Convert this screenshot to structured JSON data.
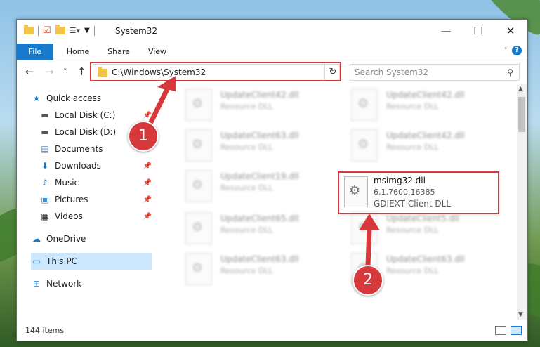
{
  "window": {
    "title": "System32",
    "controls": {
      "minimize": "—",
      "maximize": "☐",
      "close": "✕"
    }
  },
  "ribbon": {
    "tabs": [
      "File",
      "Home",
      "Share",
      "View"
    ],
    "expand_glyph": "˅",
    "help_glyph": "?"
  },
  "navigation": {
    "back_glyph": "←",
    "forward_glyph": "→",
    "recent_glyph": "˅",
    "up_glyph": "↑",
    "address_path": "C:\\Windows\\System32",
    "address_dropdown_glyph": "˅",
    "refresh_glyph": "↻",
    "search_placeholder": "Search System32",
    "search_glyph": "⚲"
  },
  "sidebar": {
    "items": [
      {
        "label": "Quick access",
        "icon": "star-icon",
        "glyph": "★",
        "pinned": false
      },
      {
        "label": "Local Disk (C:)",
        "icon": "drive-icon",
        "glyph": "▬",
        "pinned": true
      },
      {
        "label": "Local Disk (D:)",
        "icon": "drive-icon",
        "glyph": "▬",
        "pinned": true
      },
      {
        "label": "Documents",
        "icon": "documents-icon",
        "glyph": "▤",
        "pinned": true
      },
      {
        "label": "Downloads",
        "icon": "download-icon",
        "glyph": "⬇",
        "pinned": true
      },
      {
        "label": "Music",
        "icon": "music-icon",
        "glyph": "♪",
        "pinned": true
      },
      {
        "label": "Pictures",
        "icon": "pictures-icon",
        "glyph": "▣",
        "pinned": true
      },
      {
        "label": "Videos",
        "icon": "videos-icon",
        "glyph": "▦",
        "pinned": true
      },
      {
        "label": "OneDrive",
        "icon": "cloud-icon",
        "glyph": "☁",
        "pinned": false
      },
      {
        "label": "This PC",
        "icon": "computer-icon",
        "glyph": "▭",
        "pinned": false
      },
      {
        "label": "Network",
        "icon": "network-icon",
        "glyph": "⊞",
        "pinned": false
      }
    ],
    "pin_glyph": "📌"
  },
  "files": {
    "blurred": [
      {
        "name": "UpdateClient42.dll",
        "desc": "Resource DLL"
      },
      {
        "name": "UpdateClient42.dll",
        "desc": "Resource DLL"
      },
      {
        "name": "UpdateClient63.dll",
        "desc": "Resource DLL"
      },
      {
        "name": "UpdateClient42.dll",
        "desc": "Resource DLL"
      },
      {
        "name": "UpdateClient19.dll",
        "desc": "Resource DLL"
      },
      {
        "name": "UpdateClient65.dll",
        "desc": "Resource DLL"
      },
      {
        "name": "UpdateClient5.dll",
        "desc": "Resource DLL"
      },
      {
        "name": "UpdateClient63.dll",
        "desc": "Resource DLL"
      },
      {
        "name": "UpdateClient63.dll",
        "desc": "Resource DLL"
      }
    ],
    "highlighted": {
      "name": "msimg32.dll",
      "version": "6.1.7600.16385",
      "desc": "GDIEXT Client DLL"
    }
  },
  "status": {
    "item_count": "144 items"
  },
  "annotations": {
    "step1": "1",
    "step2": "2",
    "color": "#d6383b"
  }
}
